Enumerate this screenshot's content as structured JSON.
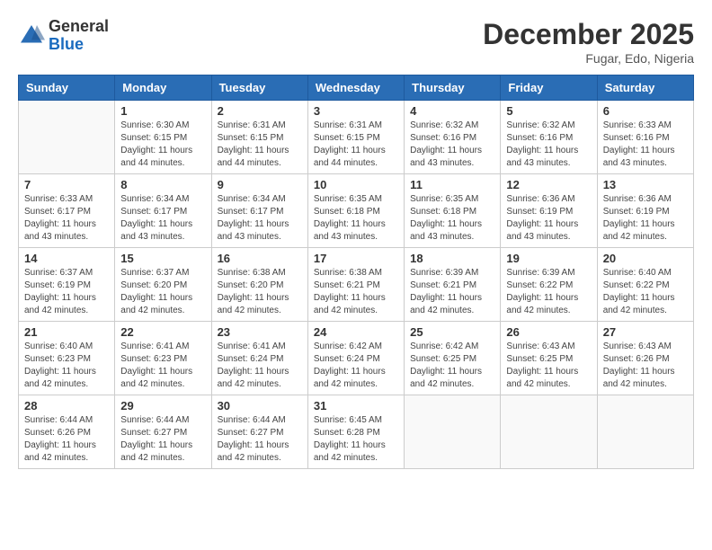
{
  "header": {
    "logo": {
      "general": "General",
      "blue": "Blue"
    },
    "title": "December 2025",
    "location": "Fugar, Edo, Nigeria"
  },
  "days_of_week": [
    "Sunday",
    "Monday",
    "Tuesday",
    "Wednesday",
    "Thursday",
    "Friday",
    "Saturday"
  ],
  "weeks": [
    [
      {
        "day": "",
        "empty": true
      },
      {
        "day": "1",
        "sunrise": "6:30 AM",
        "sunset": "6:15 PM",
        "daylight": "11 hours and 44 minutes."
      },
      {
        "day": "2",
        "sunrise": "6:31 AM",
        "sunset": "6:15 PM",
        "daylight": "11 hours and 44 minutes."
      },
      {
        "day": "3",
        "sunrise": "6:31 AM",
        "sunset": "6:15 PM",
        "daylight": "11 hours and 44 minutes."
      },
      {
        "day": "4",
        "sunrise": "6:32 AM",
        "sunset": "6:16 PM",
        "daylight": "11 hours and 43 minutes."
      },
      {
        "day": "5",
        "sunrise": "6:32 AM",
        "sunset": "6:16 PM",
        "daylight": "11 hours and 43 minutes."
      },
      {
        "day": "6",
        "sunrise": "6:33 AM",
        "sunset": "6:16 PM",
        "daylight": "11 hours and 43 minutes."
      }
    ],
    [
      {
        "day": "7",
        "sunrise": "6:33 AM",
        "sunset": "6:17 PM",
        "daylight": "11 hours and 43 minutes."
      },
      {
        "day": "8",
        "sunrise": "6:34 AM",
        "sunset": "6:17 PM",
        "daylight": "11 hours and 43 minutes."
      },
      {
        "day": "9",
        "sunrise": "6:34 AM",
        "sunset": "6:17 PM",
        "daylight": "11 hours and 43 minutes."
      },
      {
        "day": "10",
        "sunrise": "6:35 AM",
        "sunset": "6:18 PM",
        "daylight": "11 hours and 43 minutes."
      },
      {
        "day": "11",
        "sunrise": "6:35 AM",
        "sunset": "6:18 PM",
        "daylight": "11 hours and 43 minutes."
      },
      {
        "day": "12",
        "sunrise": "6:36 AM",
        "sunset": "6:19 PM",
        "daylight": "11 hours and 43 minutes."
      },
      {
        "day": "13",
        "sunrise": "6:36 AM",
        "sunset": "6:19 PM",
        "daylight": "11 hours and 42 minutes."
      }
    ],
    [
      {
        "day": "14",
        "sunrise": "6:37 AM",
        "sunset": "6:19 PM",
        "daylight": "11 hours and 42 minutes."
      },
      {
        "day": "15",
        "sunrise": "6:37 AM",
        "sunset": "6:20 PM",
        "daylight": "11 hours and 42 minutes."
      },
      {
        "day": "16",
        "sunrise": "6:38 AM",
        "sunset": "6:20 PM",
        "daylight": "11 hours and 42 minutes."
      },
      {
        "day": "17",
        "sunrise": "6:38 AM",
        "sunset": "6:21 PM",
        "daylight": "11 hours and 42 minutes."
      },
      {
        "day": "18",
        "sunrise": "6:39 AM",
        "sunset": "6:21 PM",
        "daylight": "11 hours and 42 minutes."
      },
      {
        "day": "19",
        "sunrise": "6:39 AM",
        "sunset": "6:22 PM",
        "daylight": "11 hours and 42 minutes."
      },
      {
        "day": "20",
        "sunrise": "6:40 AM",
        "sunset": "6:22 PM",
        "daylight": "11 hours and 42 minutes."
      }
    ],
    [
      {
        "day": "21",
        "sunrise": "6:40 AM",
        "sunset": "6:23 PM",
        "daylight": "11 hours and 42 minutes."
      },
      {
        "day": "22",
        "sunrise": "6:41 AM",
        "sunset": "6:23 PM",
        "daylight": "11 hours and 42 minutes."
      },
      {
        "day": "23",
        "sunrise": "6:41 AM",
        "sunset": "6:24 PM",
        "daylight": "11 hours and 42 minutes."
      },
      {
        "day": "24",
        "sunrise": "6:42 AM",
        "sunset": "6:24 PM",
        "daylight": "11 hours and 42 minutes."
      },
      {
        "day": "25",
        "sunrise": "6:42 AM",
        "sunset": "6:25 PM",
        "daylight": "11 hours and 42 minutes."
      },
      {
        "day": "26",
        "sunrise": "6:43 AM",
        "sunset": "6:25 PM",
        "daylight": "11 hours and 42 minutes."
      },
      {
        "day": "27",
        "sunrise": "6:43 AM",
        "sunset": "6:26 PM",
        "daylight": "11 hours and 42 minutes."
      }
    ],
    [
      {
        "day": "28",
        "sunrise": "6:44 AM",
        "sunset": "6:26 PM",
        "daylight": "11 hours and 42 minutes."
      },
      {
        "day": "29",
        "sunrise": "6:44 AM",
        "sunset": "6:27 PM",
        "daylight": "11 hours and 42 minutes."
      },
      {
        "day": "30",
        "sunrise": "6:44 AM",
        "sunset": "6:27 PM",
        "daylight": "11 hours and 42 minutes."
      },
      {
        "day": "31",
        "sunrise": "6:45 AM",
        "sunset": "6:28 PM",
        "daylight": "11 hours and 42 minutes."
      },
      {
        "day": "",
        "empty": true
      },
      {
        "day": "",
        "empty": true
      },
      {
        "day": "",
        "empty": true
      }
    ]
  ]
}
